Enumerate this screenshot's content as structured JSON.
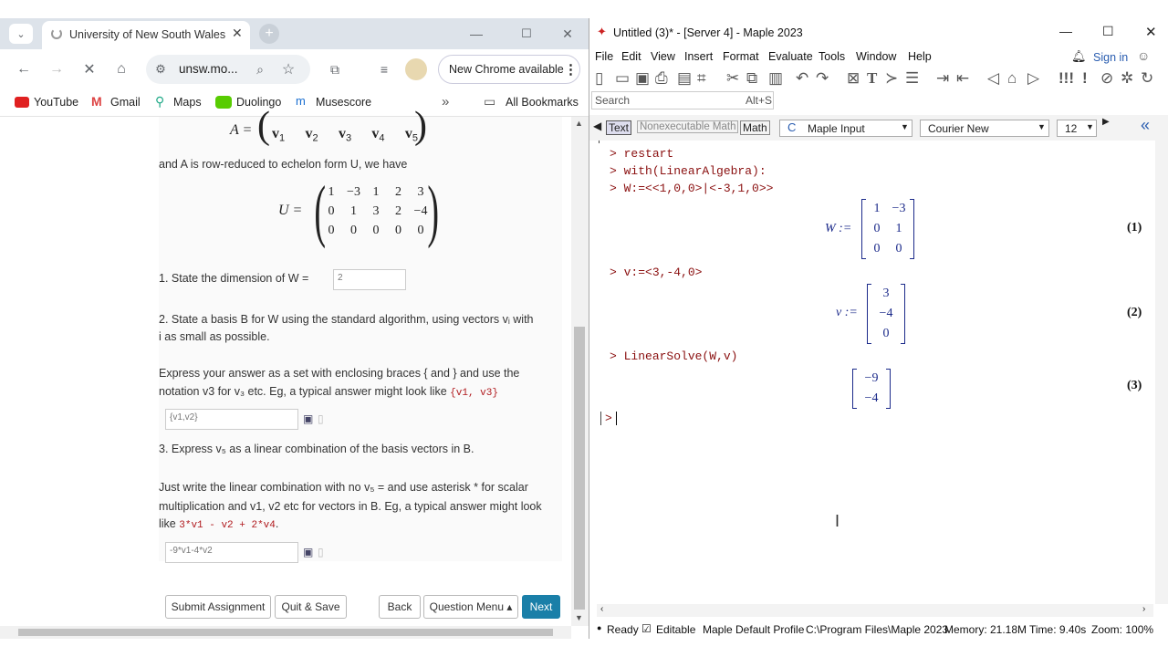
{
  "chrome": {
    "tab_title": "University of New South Wales",
    "url": "unsw.mo...",
    "update_label": "New Chrome available",
    "bookmarks": [
      "YouTube",
      "Gmail",
      "Maps",
      "Duolingo",
      "Musescore"
    ],
    "all_bookmarks": "All Bookmarks",
    "overflow": "»"
  },
  "page": {
    "matrix_A_lhs": "A =",
    "vectors": [
      "v",
      "v",
      "v",
      "v",
      "v"
    ],
    "vector_subs": [
      "1",
      "2",
      "3",
      "4",
      "5"
    ],
    "reduce_text": "and A is row-reduced to echelon form U, we have",
    "U_lhs": "U =",
    "U_rows": [
      [
        "1",
        "−3",
        "1",
        "2",
        "3"
      ],
      [
        "0",
        "1",
        "3",
        "2",
        "−4"
      ],
      [
        "0",
        "0",
        "0",
        "0",
        "0"
      ]
    ],
    "q1": "1. State the dimension of W =",
    "q1_value": "2",
    "q2a": "2. State a basis B for W using the standard algorithm, using vectors vᵢ with",
    "q2b": "i as small as possible.",
    "q2c": "Express your answer as a set with enclosing braces { and } and use the",
    "q2d": "notation v3 for v₃ etc.  Eg, a typical answer might look like",
    "q2_example": "{v1, v3}",
    "q2_value": "{v1,v2}",
    "q3": "3. Express v₅ as a linear combination of the basis vectors in B.",
    "q3b": "Just write the linear combination with no v₅ = and use asterisk * for scalar",
    "q3c": "multiplication and v1, v2 etc for vectors in B.  Eg, a typical answer might look",
    "q3d": "like",
    "q3_example": "3*v1 - v2 + 2*v4",
    "q3_value": "-9*v1-4*v2",
    "buttons": {
      "submit": "Submit Assignment",
      "quit": "Quit & Save",
      "back": "Back",
      "menu": "Question Menu ▴",
      "next": "Next"
    }
  },
  "maple": {
    "title": "Untitled (3)* - [Server 4] - Maple 2023",
    "signin": "Sign in",
    "menu": [
      "File",
      "Edit",
      "View",
      "Insert",
      "Format",
      "Evaluate",
      "Tools",
      "Window",
      "Help"
    ],
    "search_placeholder": "Search",
    "search_shortcut": "Alt+S",
    "ctx": {
      "text": "Text",
      "nonexec": "Nonexecutable Math",
      "math": "Math",
      "mode": "Maple Input",
      "font": "Courier New",
      "size": "12"
    },
    "lines": [
      "restart",
      "with(LinearAlgebra):",
      "W:=<<1,0,0>|<-3,1,0>>",
      "v:=<3,-4,0>",
      "LinearSolve(W,v)"
    ],
    "out1_lhs": "W :=",
    "out1": [
      [
        "1",
        "−3"
      ],
      [
        "0",
        "1"
      ],
      [
        "0",
        "0"
      ]
    ],
    "out2_lhs": "v :=",
    "out2": [
      "3",
      "−4",
      "0"
    ],
    "out3": [
      "−9",
      "−4"
    ],
    "eqnums": [
      "(1)",
      "(2)",
      "(3)"
    ],
    "status": {
      "ready": "Ready",
      "editable": "Editable",
      "profile": "Maple Default Profile",
      "path": "C:\\Program Files\\Maple 2023",
      "memory": "Memory: 21.18M",
      "time": "Time: 9.40s",
      "zoom": "Zoom: 100%"
    }
  }
}
